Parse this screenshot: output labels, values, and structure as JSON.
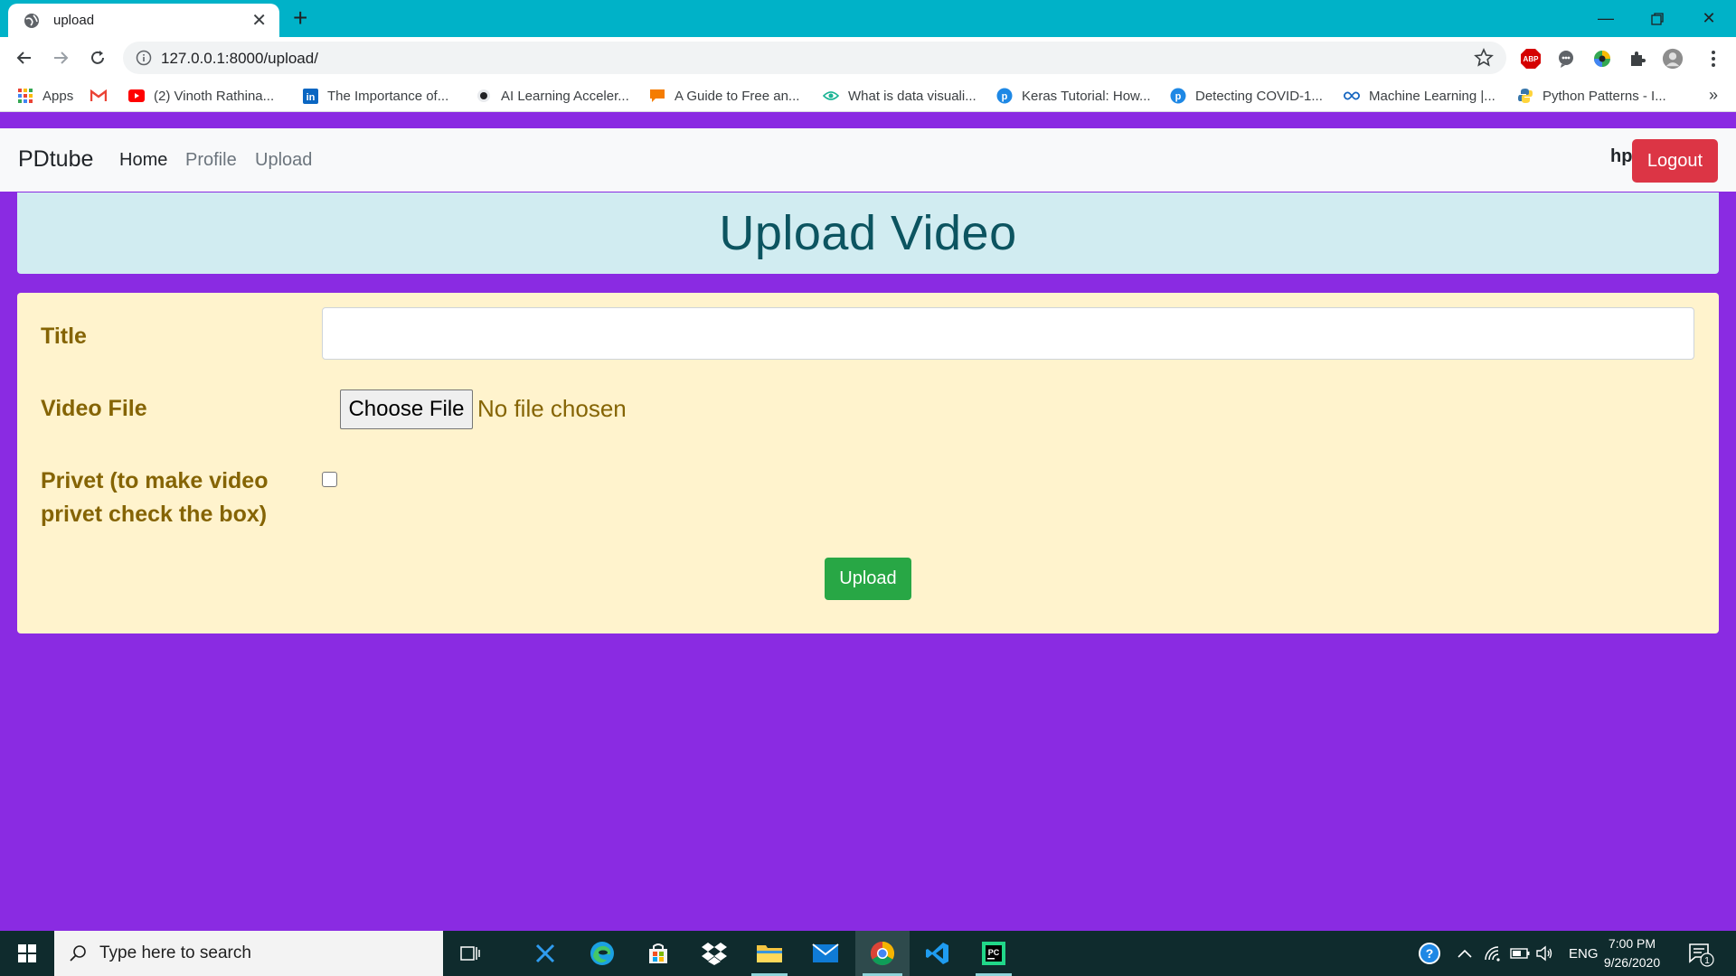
{
  "browser": {
    "tab_title": "upload",
    "url": "127.0.0.1:8000/upload/",
    "bookmarks": [
      {
        "label": "Apps",
        "icon": "apps-grid-icon"
      },
      {
        "label": "",
        "icon": "gmail-icon"
      },
      {
        "label": "(2) Vinoth Rathina...",
        "icon": "youtube-icon"
      },
      {
        "label": "The Importance of...",
        "icon": "linkedin-icon"
      },
      {
        "label": "AI Learning Acceler...",
        "icon": "dot-icon"
      },
      {
        "label": "A Guide to Free an...",
        "icon": "chat-icon"
      },
      {
        "label": "What is data visuali...",
        "icon": "eye-icon"
      },
      {
        "label": "Keras Tutorial: How...",
        "icon": "p-badge-icon"
      },
      {
        "label": "Detecting COVID-1...",
        "icon": "p-badge-icon"
      },
      {
        "label": "Machine Learning |...",
        "icon": "infinity-icon"
      },
      {
        "label": "Python Patterns - I...",
        "icon": "python-icon"
      }
    ],
    "more_glyph": "»"
  },
  "navbar": {
    "brand": "PDtube",
    "links": [
      {
        "label": "Home",
        "active": true
      },
      {
        "label": "Profile",
        "active": false
      },
      {
        "label": "Upload",
        "active": false
      }
    ],
    "user": "hp",
    "logout_label": "Logout"
  },
  "page": {
    "header": "Upload Video",
    "form": {
      "title_label": "Title",
      "title_value": "",
      "video_label": "Video File",
      "choose_file_label": "Choose File",
      "no_file_text": "No file chosen",
      "privet_label_line1": "Privet (to make video",
      "privet_label_line2": "privet check the box)",
      "privet_checked": false,
      "upload_label": "Upload"
    }
  },
  "taskbar": {
    "search_placeholder": "Type here to search",
    "language": "ENG",
    "time": "7:00 PM",
    "date": "9/26/2020",
    "notification_count": "1"
  },
  "colors": {
    "page_bg": "#8a2be2",
    "tab_strip": "#00b2c8",
    "header_bg": "#d1ecf1",
    "header_text": "#0c5460",
    "form_bg": "#fff3cd",
    "form_text": "#856404",
    "logout": "#dc3545",
    "upload": "#28a745"
  }
}
